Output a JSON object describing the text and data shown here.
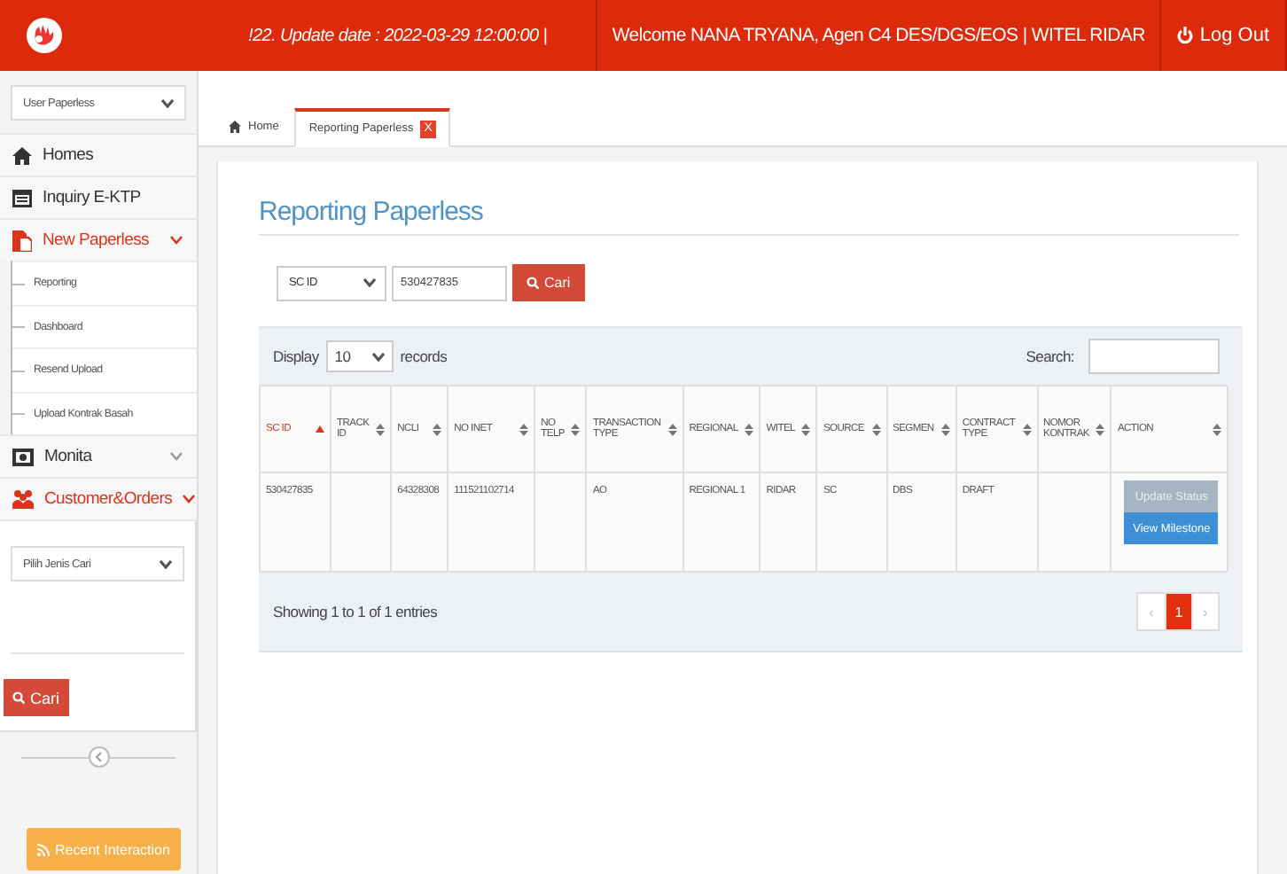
{
  "header": {
    "notice": "!22. Update date : 2022-03-29 12:00:00 |",
    "welcome": "Welcome NANA TRYANA, Agen C4 DES/DGS/EOS | WITEL RIDAR",
    "logout": "Log Out"
  },
  "sidebar": {
    "role_select": "User Paperless",
    "items": [
      {
        "kind": "link",
        "label": "Homes"
      },
      {
        "kind": "link",
        "label": "Inquiry E-KTP"
      },
      {
        "kind": "group",
        "label": "New Paperless",
        "expanded": true,
        "children": [
          {
            "label": "Reporting"
          },
          {
            "label": "Dashboard"
          },
          {
            "label": "Resend Upload"
          },
          {
            "label": "Upload Kontrak Basah"
          }
        ]
      },
      {
        "kind": "group",
        "label": "Monita",
        "expanded": false
      },
      {
        "kind": "group",
        "label": "Customer&Orders",
        "expanded": true,
        "panel": {
          "select": "Pilih Jenis Cari",
          "button": "Cari"
        }
      }
    ],
    "recent_button": "Recent Interaction"
  },
  "tabs": [
    {
      "label": "Home",
      "selected": false
    },
    {
      "label": "Reporting Paperless",
      "selected": true,
      "close": "X"
    }
  ],
  "page_title": "Reporting Paperless",
  "filter": {
    "field": "SC ID",
    "value": "530427835",
    "button": "Cari"
  },
  "table": {
    "display_label": "Display",
    "page_size": "10",
    "records_label": "records",
    "search_label": "Search:",
    "columns": [
      {
        "label": "SC ID",
        "sorted": true
      },
      {
        "label": "TRACK ID",
        "sorted": false
      },
      {
        "label": "NCLI",
        "sorted": false
      },
      {
        "label": "NO INET",
        "sorted": false
      },
      {
        "label": "NO TELP",
        "sorted": false
      },
      {
        "label": "TRANSACTION TYPE",
        "sorted": false
      },
      {
        "label": "REGIONAL",
        "sorted": false
      },
      {
        "label": "WITEL",
        "sorted": false
      },
      {
        "label": "SOURCE",
        "sorted": false
      },
      {
        "label": "SEGMEN",
        "sorted": false
      },
      {
        "label": "CONTRACT TYPE",
        "sorted": false
      },
      {
        "label": "NOMOR KONTRAK",
        "sorted": false
      },
      {
        "label": "ACTION",
        "sorted": false
      }
    ],
    "rows": [
      {
        "cells": [
          "530427835",
          null,
          "64328308",
          "111521102714",
          null,
          "AO",
          "REGIONAL 1",
          "RIDAR",
          "SC",
          "DBS",
          "DRAFT",
          null
        ],
        "actions": [
          {
            "label": "Update Status",
            "disabled": true
          },
          {
            "label": "View Milestone",
            "disabled": false
          }
        ]
      }
    ],
    "info": "Showing 1 to 1 of 1 entries",
    "pagination": [
      {
        "label": "‹",
        "selected": false,
        "disabled": true
      },
      {
        "label": "1",
        "selected": true,
        "disabled": false
      },
      {
        "label": "›",
        "selected": false,
        "disabled": true
      }
    ]
  }
}
